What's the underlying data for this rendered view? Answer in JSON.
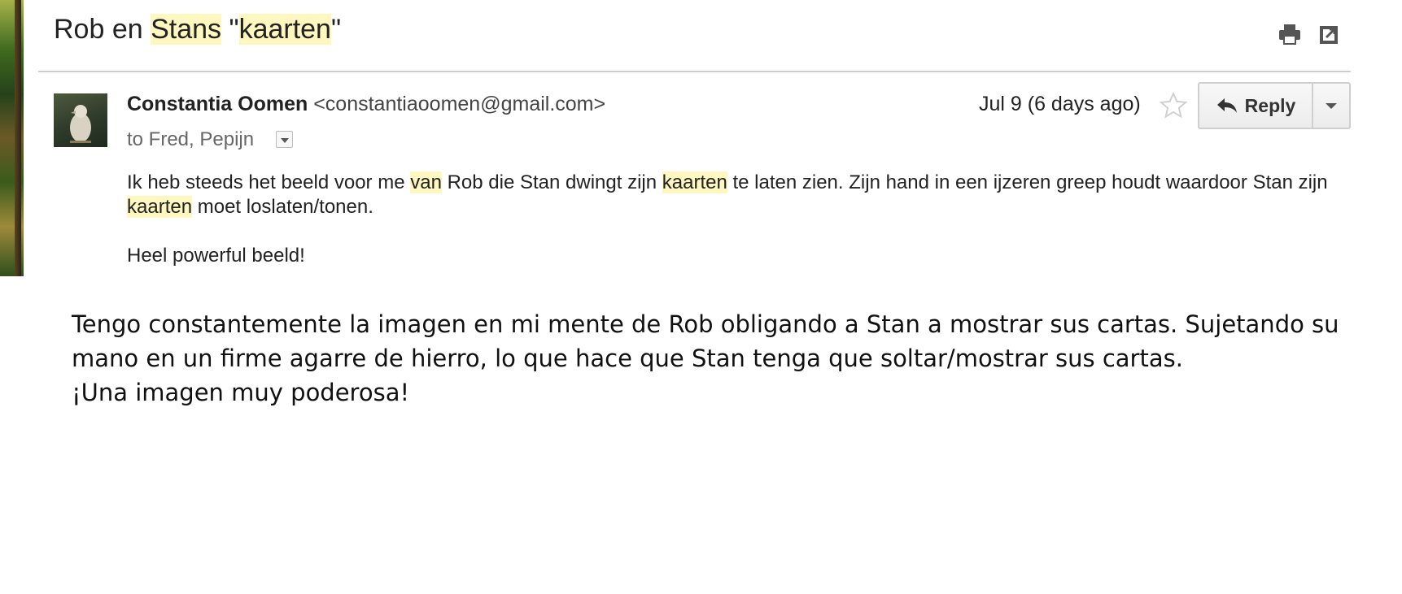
{
  "subject": {
    "parts": [
      "Rob en ",
      "Stans",
      " \"",
      "kaarten",
      "\""
    ]
  },
  "toolbar_icons": [
    "print-icon",
    "open-in-new-window-icon"
  ],
  "message": {
    "sender_name": "Constantia Oomen",
    "sender_email": "<constantiaoomen@gmail.com>",
    "recipients": "to Fred, Pepijn",
    "date": "Jul 9 (6 days ago)",
    "reply_label": "Reply",
    "body": {
      "p1": [
        "Ik heb steeds het beeld voor me ",
        "van",
        " Rob die Stan dwingt zijn ",
        "kaarten",
        " te laten zien. Zijn hand in een ijzeren greep houdt waardoor Stan zijn ",
        "kaarten",
        " moet loslaten/tonen."
      ],
      "p2": "Heel powerful beeld!"
    }
  },
  "translation": {
    "line1": "Tengo constantemente la imagen en mi mente de Rob obligando a Stan a mostrar sus cartas. Sujetando su mano en un firme agarre de hierro, lo que hace que Stan tenga que soltar/mostrar sus cartas.",
    "line2": "¡Una imagen muy poderosa!"
  },
  "colors": {
    "highlight": "#fff7c0",
    "divider": "#cfcfcf",
    "text": "#222222"
  }
}
